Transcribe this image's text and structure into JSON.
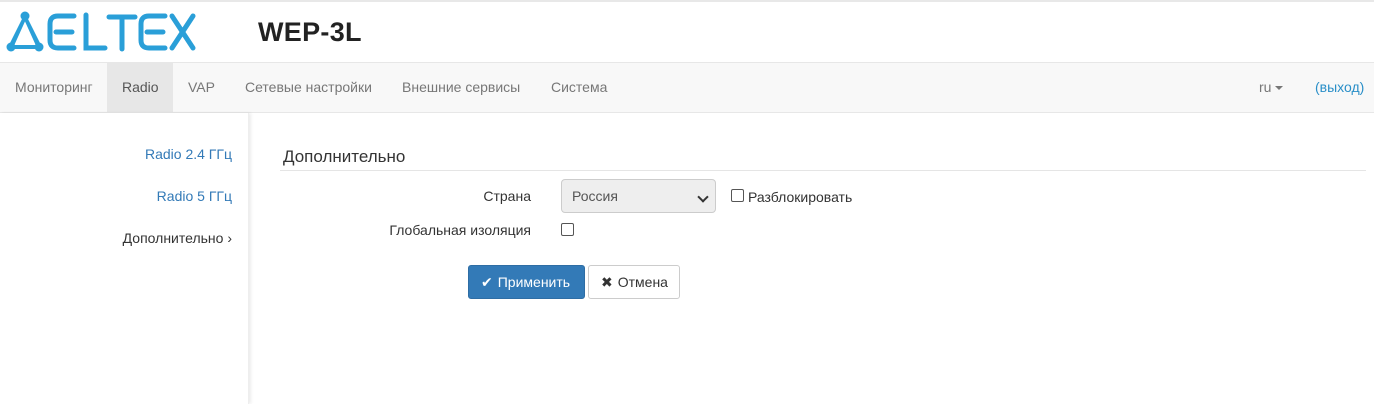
{
  "brand": {
    "logo_text": "ELTEX",
    "model": "WEP-3L",
    "color": "#2a9fd8"
  },
  "nav": {
    "items": [
      {
        "label": "Мониторинг"
      },
      {
        "label": "Radio",
        "active": true
      },
      {
        "label": "VAP"
      },
      {
        "label": "Сетевые настройки"
      },
      {
        "label": "Внешние сервисы"
      },
      {
        "label": "Система"
      }
    ],
    "language": "ru",
    "logout": "(выход)"
  },
  "sidebar": {
    "items": [
      {
        "label": "Radio 2.4 ГГц"
      },
      {
        "label": "Radio 5 ГГц"
      },
      {
        "label": "Дополнительно ›"
      }
    ]
  },
  "section": {
    "title": "Дополнительно",
    "country_label": "Страна",
    "country_value": "Россия",
    "unlock_label": "Разблокировать",
    "unlock_checked": false,
    "isolation_label": "Глобальная изоляция",
    "isolation_checked": false
  },
  "buttons": {
    "apply_label": "Применить",
    "apply_icon": "✔",
    "cancel_label": "Отмена",
    "cancel_icon": "✖"
  },
  "colors": {
    "primary": "#337ab7",
    "link": "#337ab7",
    "logout": "#2a8fc8"
  }
}
